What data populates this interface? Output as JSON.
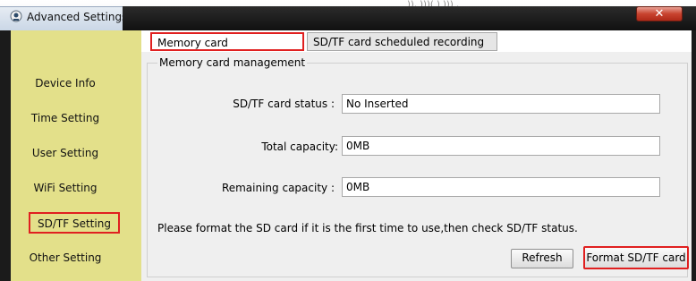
{
  "window": {
    "title": "Advanced Settings",
    "close_glyph": "✕",
    "top_partial_text": ")), )))( ) ))) ,",
    "app_icon": "app-icon"
  },
  "sidebar": {
    "items": [
      {
        "label": "Device Info",
        "active": false
      },
      {
        "label": "Time Setting",
        "active": false
      },
      {
        "label": "User Setting",
        "active": false
      },
      {
        "label": "WiFi Setting",
        "active": false
      },
      {
        "label": "SD/TF Setting",
        "active": true
      },
      {
        "label": "Other Setting",
        "active": false
      }
    ]
  },
  "tabs": [
    {
      "label": "Memory card management",
      "active": true
    },
    {
      "label": "SD/TF card scheduled recording",
      "active": false
    }
  ],
  "group": {
    "title": "Memory card management",
    "fields": [
      {
        "label": "SD/TF card status :",
        "value": "No Inserted"
      },
      {
        "label": "Total capacity:",
        "value": "0MB"
      },
      {
        "label": "Remaining capacity :",
        "value": "0MB"
      }
    ],
    "hint": "Please format the SD card if it is the first time to use,then check SD/TF status."
  },
  "buttons": {
    "refresh": "Refresh",
    "format": "Format SD/TF card"
  },
  "colors": {
    "sidebar_bg": "#e3e08a",
    "highlight_red": "#e02020",
    "close_red": "#c8432f"
  }
}
